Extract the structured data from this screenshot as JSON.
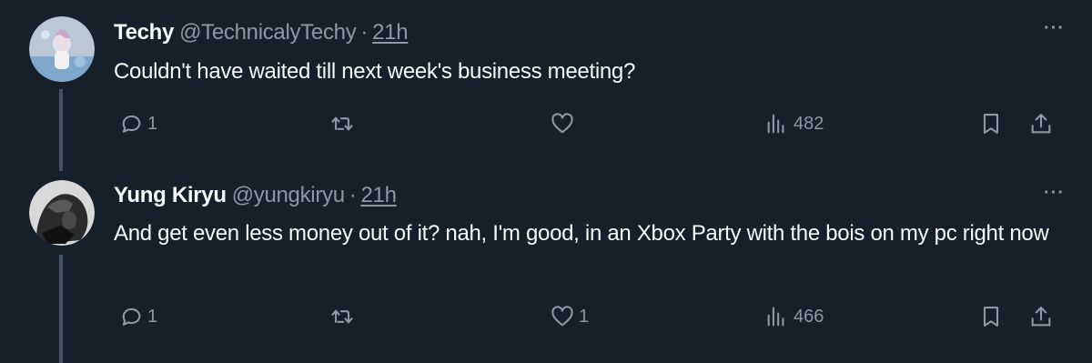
{
  "tweets": [
    {
      "name": "Techy",
      "handle": "@TechnicalyTechy",
      "separator": "·",
      "time": "21h",
      "text": "Couldn't have waited till next week's business meeting?",
      "more": "···",
      "replies": "1",
      "retweets": "",
      "likes": "",
      "views": "482"
    },
    {
      "name": "Yung Kiryu",
      "handle": "@yungkiryu",
      "separator": "·",
      "time": "21h",
      "text": "And get even less money out of it? nah, I'm good, in an Xbox Party with the bois on my pc right now",
      "more": "···",
      "replies": "1",
      "retweets": "",
      "likes": "1",
      "views": "466"
    }
  ],
  "colors": {
    "background": "#15202b",
    "text": "#f7f9f9",
    "secondary_text": "#8b98a5",
    "thread_line": "#425364"
  },
  "icons": [
    "reply-icon",
    "retweet-icon",
    "like-icon",
    "views-icon",
    "bookmark-icon",
    "share-icon",
    "more-icon"
  ]
}
